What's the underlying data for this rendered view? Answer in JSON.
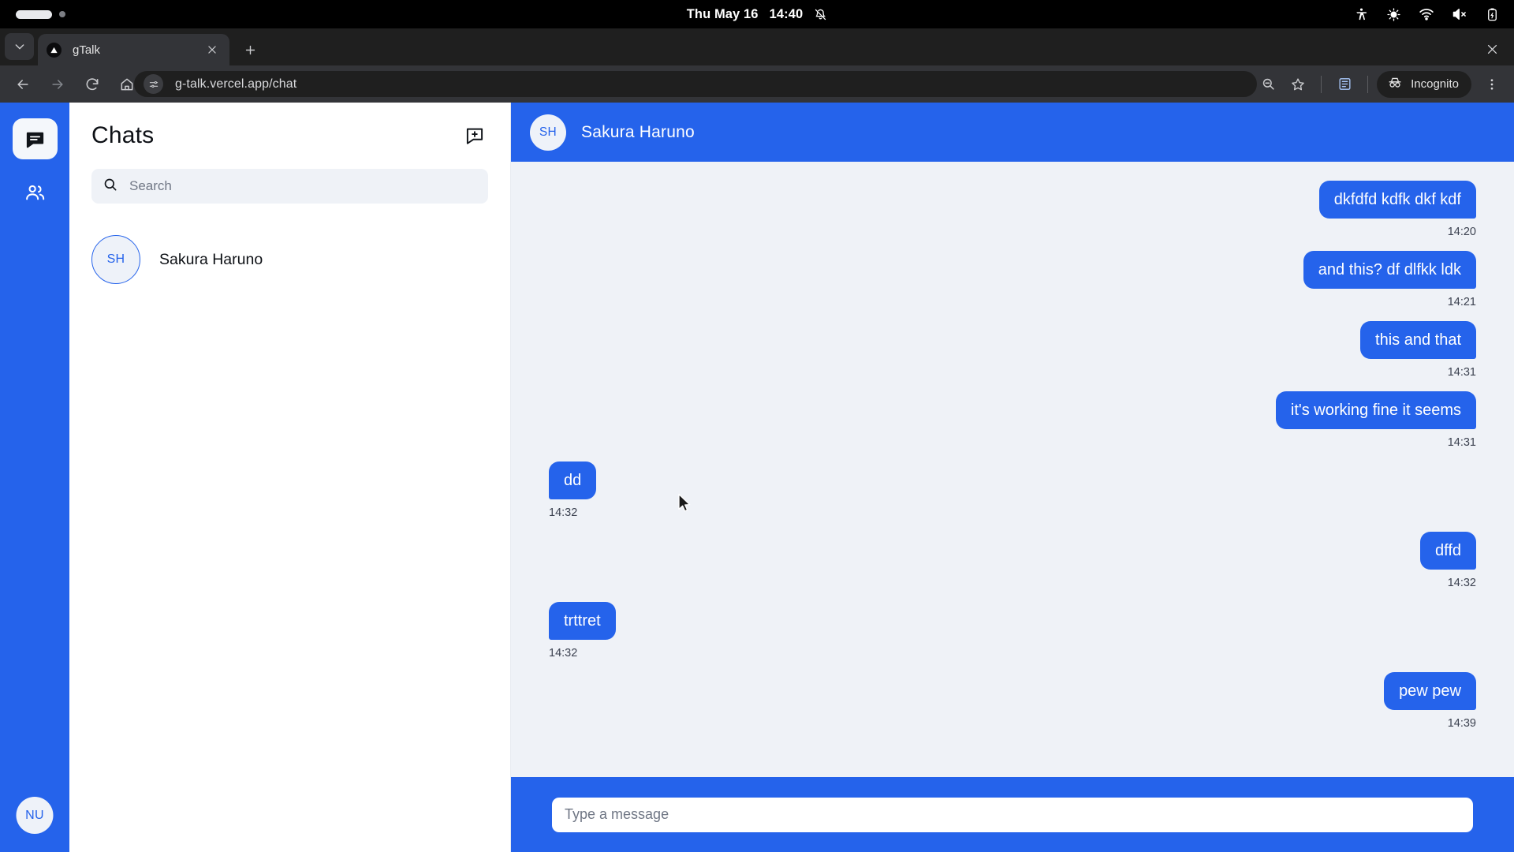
{
  "system_bar": {
    "clock_date": "Thu May 16",
    "clock_time": "14:40",
    "notification_icon": "bell-off-icon",
    "tray_icons": [
      "accessibility-icon",
      "display-brightness-icon",
      "wifi-icon",
      "volume-muted-icon",
      "battery-charging-icon"
    ]
  },
  "browser": {
    "tab": {
      "title": "gTalk",
      "favicon": "vercel-triangle-icon"
    },
    "new_tab_label": "+",
    "url": "g-talk.vercel.app/chat",
    "profile_label": "Incognito",
    "nav_icons": [
      "back-icon",
      "forward-icon",
      "reload-icon",
      "home-icon"
    ],
    "action_icons": [
      "zoom-out-icon",
      "bookmark-star-icon",
      "reading-list-icon",
      "incognito-icon",
      "three-dot-menu-icon"
    ]
  },
  "app": {
    "rail": {
      "items": [
        {
          "name": "chats",
          "icon": "chat-bubble-icon",
          "active": true
        },
        {
          "name": "contacts",
          "icon": "people-icon",
          "active": false
        }
      ],
      "user_avatar_initials": "NU"
    },
    "chat_list": {
      "title": "Chats",
      "new_chat_icon": "new-chat-icon",
      "search_placeholder": "Search",
      "search_value": "",
      "contacts": [
        {
          "initials": "SH",
          "name": "Sakura Haruno"
        }
      ]
    },
    "conversation": {
      "header": {
        "initials": "SH",
        "name": "Sakura Haruno"
      },
      "messages": [
        {
          "text": "dkfdfd kdfk dkf kdf",
          "time": "14:20",
          "direction": "out"
        },
        {
          "text": "and this? df dlfkk ldk",
          "time": "14:21",
          "direction": "out"
        },
        {
          "text": "this and that",
          "time": "14:31",
          "direction": "out"
        },
        {
          "text": "it's working fine it seems",
          "time": "14:31",
          "direction": "out"
        },
        {
          "text": "dd",
          "time": "14:32",
          "direction": "in"
        },
        {
          "text": "dffd",
          "time": "14:32",
          "direction": "out"
        },
        {
          "text": "trttret",
          "time": "14:32",
          "direction": "in"
        },
        {
          "text": "pew pew",
          "time": "14:39",
          "direction": "out"
        }
      ],
      "composer_placeholder": "Type a message",
      "composer_value": ""
    }
  },
  "colors": {
    "brand_blue": "#2563eb",
    "messages_bg": "#eff2f7",
    "chrome_dark": "#333438",
    "tabstrip_dark": "#1f1f1f"
  }
}
